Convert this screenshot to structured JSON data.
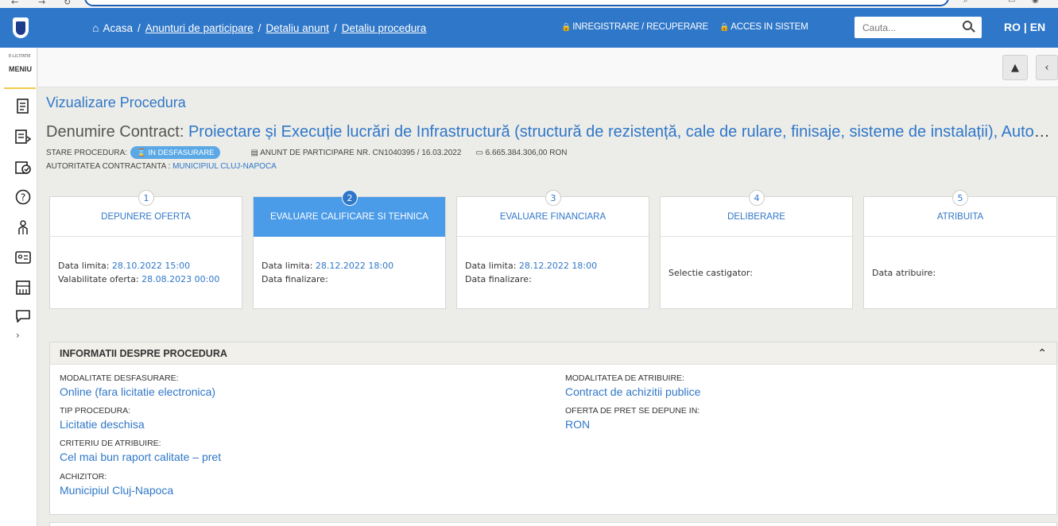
{
  "nav": {
    "home": "Acasa",
    "crumbs": [
      "Anunturi de participare",
      "Detaliu anunt",
      "Detaliu procedura"
    ],
    "register": "INREGISTRARE / RECUPERARE",
    "login": "ACCES IN SISTEM",
    "search_placeholder": "Cauta...",
    "lang": "RO | EN"
  },
  "sidebar": {
    "brand": "E-LICITATIE",
    "menu": "MENIU"
  },
  "page": {
    "title": "Vizualizare Procedura",
    "contract_label": "Denumire Contract:",
    "contract_name": "Proiectare și Execuție lucrări de Infrastructură (structură de rezistență, cale de rulare, finisaje, sisteme de instalații), Automatizare și",
    "status_label": "STARE PROCEDURA:",
    "status": "IN DESFASURARE",
    "notice": "ANUNT DE PARTICIPARE NR. CN1040395 / 16.03.2022",
    "value": "6.665.384.306,00  RON",
    "authority_label": "AUTORITATEA CONTRACTANTA :",
    "authority": "MUNICIPIUL CLUJ-NAPOCA"
  },
  "steps": [
    {
      "num": "1",
      "title": "DEPUNERE OFERTA",
      "lines": [
        [
          "Data limita: ",
          "28.10.2022 15:00"
        ],
        [
          "Valabilitate oferta: ",
          "28.08.2023 00:00"
        ]
      ]
    },
    {
      "num": "2",
      "title": "EVALUARE CALIFICARE SI TEHNICA",
      "active": true,
      "lines": [
        [
          "Data limita: ",
          "28.12.2022 18:00"
        ],
        [
          "Data finalizare: ",
          ""
        ]
      ]
    },
    {
      "num": "3",
      "title": "EVALUARE FINANCIARA",
      "lines": [
        [
          "Data limita: ",
          "28.12.2022 18:00"
        ],
        [
          "Data finalizare: ",
          ""
        ]
      ]
    },
    {
      "num": "4",
      "title": "DELIBERARE",
      "lines": [
        [
          "Selectie castigator: ",
          ""
        ]
      ]
    },
    {
      "num": "5",
      "title": "ATRIBUITA",
      "lines": [
        [
          "Data atribuire: ",
          ""
        ]
      ]
    }
  ],
  "info": {
    "title": "INFORMATII DESPRE PROCEDURA",
    "left": [
      {
        "k": "MODALITATE DESFASURARE:",
        "v": "Online (fara licitatie electronica)"
      },
      {
        "k": "TIP PROCEDURA:",
        "v": "Licitatie deschisa"
      },
      {
        "k": "CRITERIU DE ATRIBUIRE:",
        "v": "Cel mai bun raport calitate – pret"
      },
      {
        "k": "ACHIZITOR:",
        "v": "Municipiul Cluj-Napoca"
      }
    ],
    "right": [
      {
        "k": "MODALITATEA DE ATRIBUIRE:",
        "v": "Contract de achizitii publice"
      },
      {
        "k": "OFERTA DE PRET SE DEPUNE IN:",
        "v": "RON"
      }
    ]
  },
  "colors": {
    "primary": "#2f77c8",
    "active_step": "#4a9be8",
    "status_pill": "#5aa9e6",
    "accent": "#f2c94c"
  },
  "icons": [
    "home-icon",
    "lock-icon",
    "search-icon",
    "document-icon",
    "list-arrow-icon",
    "folder-check-icon",
    "help-icon",
    "people-icon",
    "id-card-icon",
    "building-icon",
    "chat-icon",
    "chevron-right-icon",
    "chevron-up-icon",
    "chevron-left-icon",
    "hourglass-icon",
    "cash-icon"
  ]
}
